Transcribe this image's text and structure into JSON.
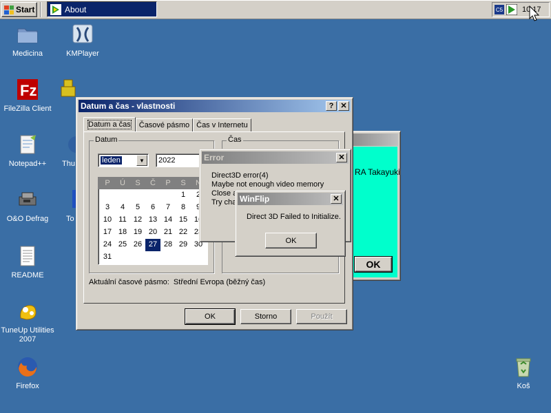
{
  "taskbar": {
    "start_label": "Start",
    "task_label": "About",
    "tray_icon_letter": "C5",
    "clock": "10:17"
  },
  "desktop": {
    "icons": [
      {
        "label": "Medicina",
        "icon": "folder-icon"
      },
      {
        "label": "KMPlayer",
        "icon": "kmplayer-icon"
      },
      {
        "label": "FileZilla Client",
        "icon": "filezilla-icon"
      },
      {
        "label": "Notepad++",
        "icon": "notepad-icon"
      },
      {
        "label": "Thu",
        "icon": "thunderbird-icon"
      },
      {
        "label": "O&O Defrag",
        "icon": "defrag-icon"
      },
      {
        "label": "To",
        "icon": "app-icon"
      },
      {
        "label": "README",
        "icon": "text-file-icon"
      },
      {
        "label": "TuneUp Utilities 2007",
        "icon": "tuneup-icon"
      },
      {
        "label": "Firefox",
        "icon": "firefox-icon"
      },
      {
        "label": "Koš",
        "icon": "recycle-bin-icon"
      }
    ]
  },
  "datetime_window": {
    "title": "Datum a čas - vlastnosti",
    "help_btn": "?",
    "close_btn": "✕",
    "tabs": [
      "Datum a čas",
      "Časové pásmo",
      "Čas v Internetu"
    ],
    "date_group": "Datum",
    "time_group": "Čas",
    "month": "leden",
    "year": "2022",
    "weekdays": [
      "P",
      "Ú",
      "S",
      "Č",
      "P",
      "S",
      "N"
    ],
    "weeks": [
      [
        "",
        "",
        "",
        "",
        "",
        "1",
        "2"
      ],
      [
        "3",
        "4",
        "5",
        "6",
        "7",
        "8",
        "9"
      ],
      [
        "10",
        "11",
        "12",
        "13",
        "14",
        "15",
        "16"
      ],
      [
        "17",
        "18",
        "19",
        "20",
        "21",
        "22",
        "23"
      ],
      [
        "24",
        "25",
        "26",
        "27",
        "28",
        "29",
        "30"
      ],
      [
        "31",
        "",
        "",
        "",
        "",
        "",
        ""
      ]
    ],
    "selected_day": "27",
    "timezone_label": "Aktuální časové pásmo:",
    "timezone_value": "Střední Evropa (běžný čas)",
    "ok": "OK",
    "cancel": "Storno",
    "apply": "Použít"
  },
  "green_window": {
    "text_fragment": "RA Takayuki",
    "ok": "OK"
  },
  "error_window": {
    "title": "Error",
    "close_btn": "✕",
    "lines": [
      "Direct3D error(4)",
      "Maybe not enough video memory",
      "Close a",
      "Try cha"
    ]
  },
  "winflip_window": {
    "title": "WinFlip",
    "close_btn": "✕",
    "message": "Direct 3D Failed to Initialize.",
    "ok": "OK"
  }
}
